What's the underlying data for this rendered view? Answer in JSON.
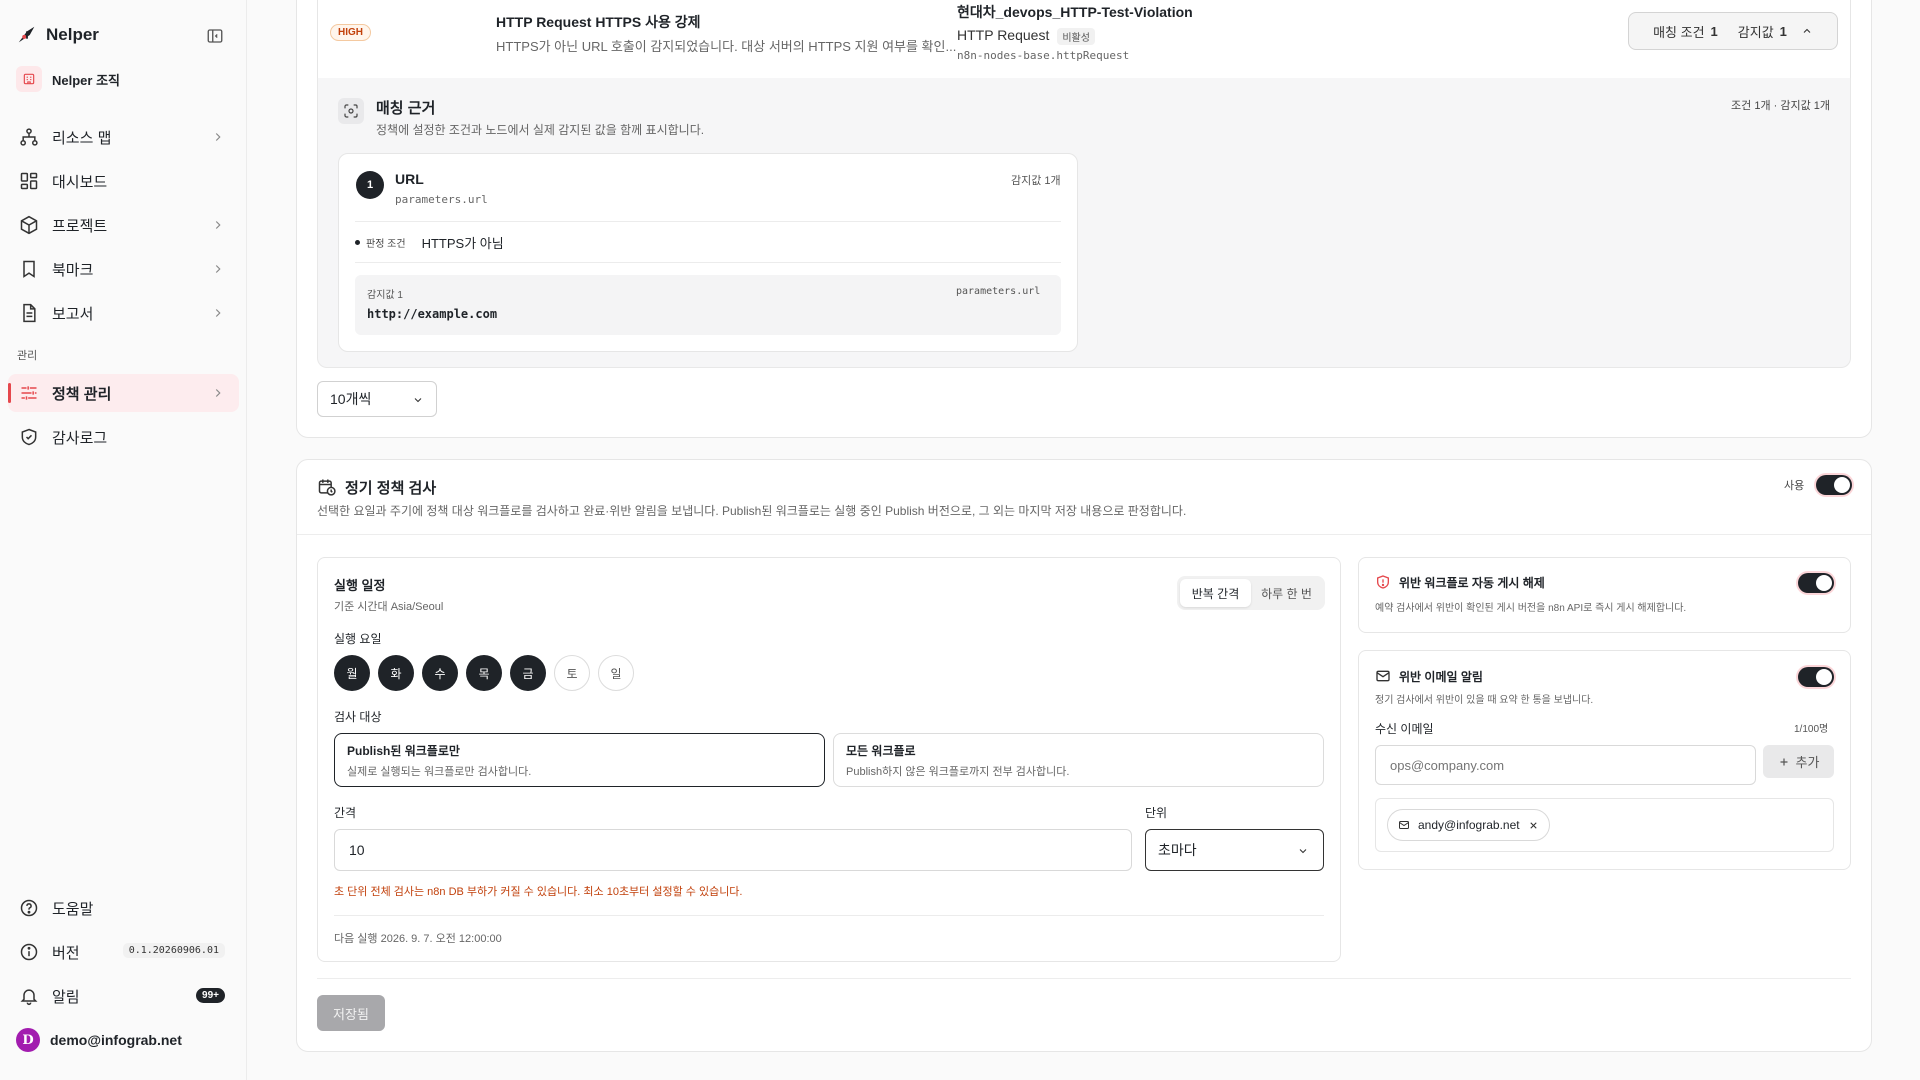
{
  "sidebar": {
    "brand": "Nelper",
    "org": "Nelper 조직",
    "items": [
      {
        "label": "리소스 맵"
      },
      {
        "label": "대시보드"
      },
      {
        "label": "프로젝트"
      },
      {
        "label": "북마크"
      },
      {
        "label": "보고서"
      }
    ],
    "section_label": "관리",
    "admin_items": [
      {
        "label": "정책 관리"
      },
      {
        "label": "감사로그"
      }
    ],
    "bottom_items": [
      {
        "label": "도움말"
      },
      {
        "label": "버전",
        "badge": "0.1.20260906.01"
      },
      {
        "label": "알림",
        "badge": "99+"
      }
    ],
    "user": {
      "initial": "D",
      "email": "demo@infograb.net"
    }
  },
  "violation": {
    "severity": "HIGH",
    "policy_title": "HTTP Request HTTPS 사용 강제",
    "policy_desc": "HTTPS가 아닌 URL 호출이 감지되었습니다. 대상 서버의 HTTPS 지원 여부를 확인...",
    "workflow_name": "현대차_devops_HTTP-Test-Violation",
    "node_name": "HTTP Request",
    "node_status": "비활성",
    "node_type": "n8n-nodes-base.httpRequest",
    "match_label": "매칭 조건",
    "match_count": "1",
    "detect_label": "감지값",
    "detect_count": "1"
  },
  "evidence": {
    "title": "매칭 근거",
    "desc": "정책에 설정한 조건과 노드에서 실제 감지된 값을 함께 표시합니다.",
    "summary": "조건 1개 · 감지값 1개",
    "condition": {
      "index": "1",
      "field": "URL",
      "path": "parameters.url",
      "detect_count": "감지값 1개",
      "rule_label": "판정 조건",
      "rule_value": "HTTPS가 아님",
      "value_label": "감지값 1",
      "value_path": "parameters.url",
      "value": "http://example.com"
    }
  },
  "pagination": {
    "page_size": "10개씩"
  },
  "schedule": {
    "title": "정기 정책 검사",
    "desc": "선택한 요일과 주기에 정책 대상 워크플로를 검사하고 완료·위반 알림을 보냅니다. Publish된 워크플로는 실행 중인 Publish 버전으로, 그 외는 마지막 저장 내용으로 판정합니다.",
    "enable_label": "사용",
    "enabled": true,
    "run_title": "실행 일정",
    "timezone": "기준 시간대 Asia/Seoul",
    "mode_options": [
      "반복 간격",
      "하루 한 번"
    ],
    "mode_selected": "반복 간격",
    "days_label": "실행 요일",
    "days": [
      {
        "label": "월",
        "on": true
      },
      {
        "label": "화",
        "on": true
      },
      {
        "label": "수",
        "on": true
      },
      {
        "label": "목",
        "on": true
      },
      {
        "label": "금",
        "on": true
      },
      {
        "label": "토",
        "on": false
      },
      {
        "label": "일",
        "on": false
      }
    ],
    "target_label": "검사 대상",
    "targets": [
      {
        "title": "Publish된 워크플로만",
        "desc": "실제로 실행되는 워크플로만 검사합니다.",
        "selected": true
      },
      {
        "title": "모든 워크플로",
        "desc": "Publish하지 않은 워크플로까지 전부 검사합니다.",
        "selected": false
      }
    ],
    "interval_label": "간격",
    "interval_value": "10",
    "unit_label": "단위",
    "unit_value": "초마다",
    "warning": "초 단위 전체 검사는 n8n DB 부하가 커질 수 있습니다. 최소 10초부터 설정할 수 있습니다.",
    "next_run": "다음 실행 2026. 9. 7. 오전 12:00:00",
    "auto_unpublish": {
      "title": "위반 워크플로 자동 게시 해제",
      "desc": "예약 검사에서 위반이 확인된 게시 버전을 n8n API로 즉시 게시 해제합니다.",
      "enabled": true
    },
    "email_alert": {
      "title": "위반 이메일 알림",
      "desc": "정기 검사에서 위반이 있을 때 요약 한 통을 보냅니다.",
      "enabled": true,
      "recipients_label": "수신 이메일",
      "recipients_count": "1/100명",
      "placeholder": "ops@company.com",
      "add_label": "추가",
      "recipients": [
        "andy@infograb.net"
      ]
    },
    "save_label": "저장됨"
  },
  "colors": {
    "accent": "#e5484d",
    "dark": "#1f2328",
    "warning": "#c2410c"
  }
}
